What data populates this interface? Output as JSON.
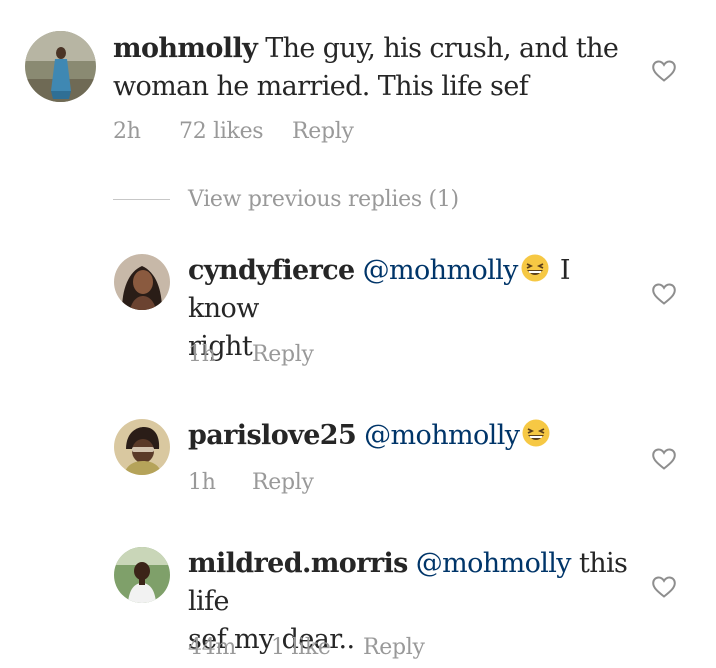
{
  "comments": [
    {
      "username": "mohmolly",
      "mention": "",
      "text_before": "The guy, his crush, and the",
      "text_line2": "woman he married. This life sef",
      "time": "2h",
      "likes": "72 likes",
      "reply": "Reply"
    },
    {
      "username": "cyndyfierce",
      "mention": "@mohmolly",
      "text_after_emoji": "I know",
      "text_line2": "right",
      "emoji": "grinning-squinting-face-emoji",
      "time": "1h",
      "reply": "Reply"
    },
    {
      "username": "parislove25",
      "mention": "@mohmolly",
      "emoji": "grinning-squinting-face-emoji",
      "time": "1h",
      "reply": "Reply"
    },
    {
      "username": "mildred.morris",
      "mention": "@mohmolly",
      "text_after": "this life",
      "text_line2": "sef my dear..",
      "time": "44m",
      "likes": "1 like",
      "reply": "Reply"
    }
  ],
  "view_previous": "View previous replies (1)",
  "icons": {
    "like": "heart-outline-icon"
  },
  "colors": {
    "text": "#262626",
    "mention": "#003569",
    "meta": "#999999"
  }
}
